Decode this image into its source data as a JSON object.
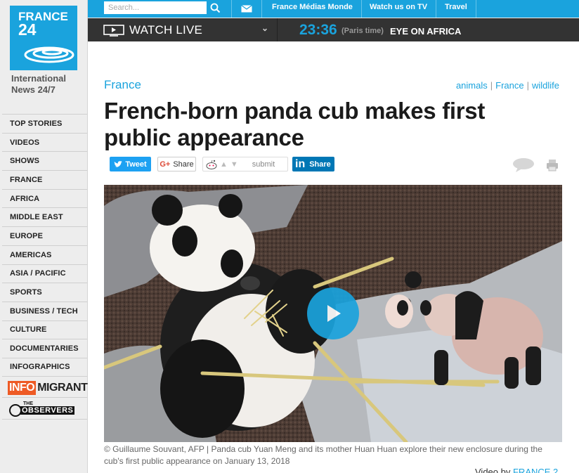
{
  "brand": {
    "logo_line1": "FRANCE",
    "logo_line2": "24",
    "tagline": "International News 24/7",
    "accent": "#1aa3dd"
  },
  "topbar": {
    "search_placeholder": "Search...",
    "links": [
      "France Médias Monde",
      "Watch us on TV",
      "Travel"
    ]
  },
  "livebar": {
    "watch_label": "WATCH LIVE",
    "time": "23:36",
    "timezone": "(Paris time)",
    "program": "EYE ON AFRICA"
  },
  "sidebar": {
    "items": [
      {
        "label": "TOP STORIES"
      },
      {
        "label": "VIDEOS"
      },
      {
        "label": "SHOWS"
      },
      {
        "label": "FRANCE"
      },
      {
        "label": "AFRICA"
      },
      {
        "label": "MIDDLE EAST"
      },
      {
        "label": "EUROPE"
      },
      {
        "label": "AMERICAS"
      },
      {
        "label": "ASIA / PACIFIC"
      },
      {
        "label": "SPORTS"
      },
      {
        "label": "BUSINESS / TECH"
      },
      {
        "label": "CULTURE"
      },
      {
        "label": "DOCUMENTARIES"
      },
      {
        "label": "INFOGRAPHICS"
      }
    ],
    "infomigrants_a": "INFO",
    "infomigrants_b": "MIGRANTS",
    "observers_the": "THE",
    "observers_name": "OBSERVERS"
  },
  "article": {
    "section": "France",
    "tags": [
      "animals",
      "France",
      "wildlife"
    ],
    "title": "French-born panda cub makes first public appearance",
    "share": {
      "tweet": "Tweet",
      "gplus_g": "G+",
      "gplus": "Share",
      "reddit_submit": "submit",
      "linkedin_in": "in",
      "linkedin": "Share"
    },
    "caption": "© Guillaume Souvant, AFP | Panda cub Yuan Meng and its mother Huan Huan explore their new enclosure during the cub's first public appearance on January 13, 2018",
    "credit_prefix": "Video by",
    "credit_source": "FRANCE 2"
  }
}
